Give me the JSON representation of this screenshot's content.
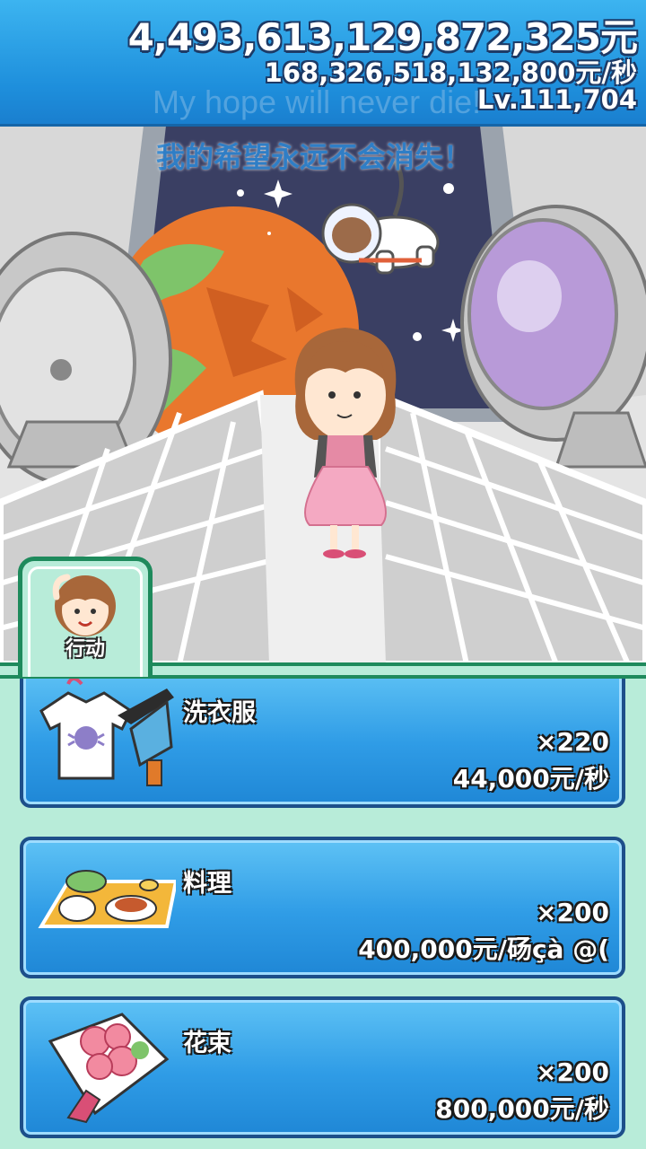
{
  "header": {
    "money": "4,493,613,129,872,325元",
    "rate": "168,326,518,132,800元/秒",
    "level": "Lv.111,704"
  },
  "messages": {
    "english": "My hope will never die!",
    "chinese": "我的希望永远不会消失！"
  },
  "tab": {
    "label": "行动"
  },
  "actions": [
    {
      "name": "洗衣服",
      "count": "×220",
      "rate": "44,000元/秒",
      "icon": "laundry-icon"
    },
    {
      "name": "料理",
      "count": "×200",
      "rate": "400,000元/砀çà @(",
      "icon": "meal-tray-icon"
    },
    {
      "name": "花束",
      "count": "×200",
      "rate": "800,000元/秒",
      "icon": "bouquet-icon"
    }
  ],
  "colors": {
    "header_blue": "#1e8fdc",
    "card_blue": "#2f9ce6",
    "mint_bg": "#b8ecd9",
    "tab_border": "#1e8a5c"
  }
}
